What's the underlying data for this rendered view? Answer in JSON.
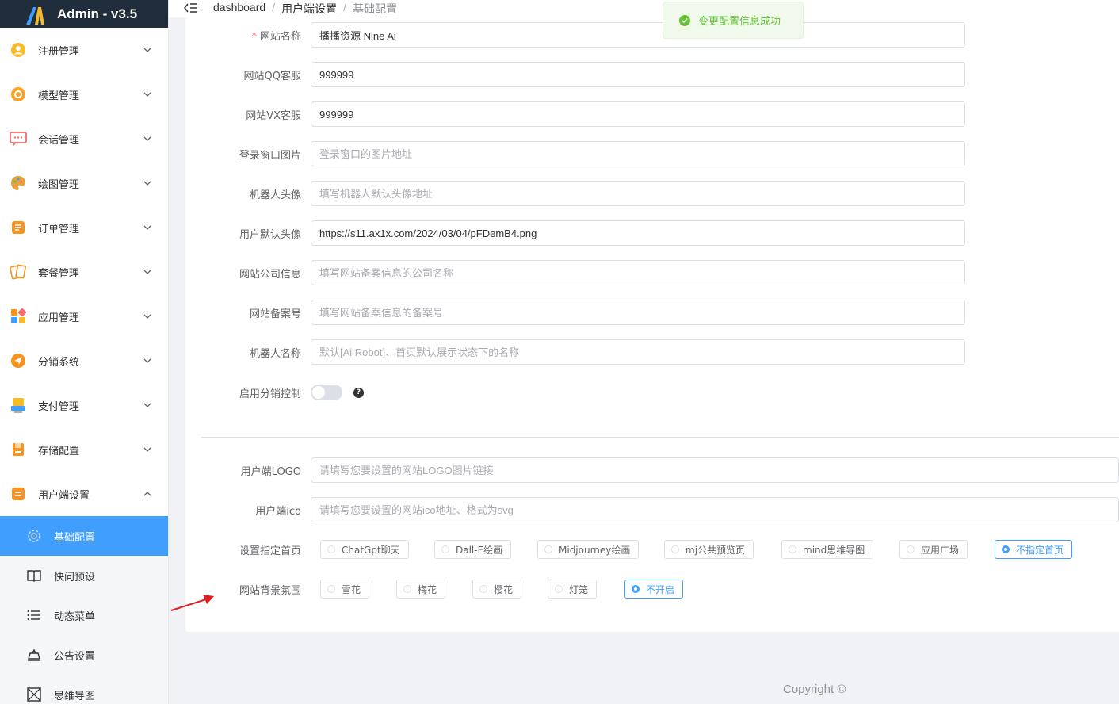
{
  "app": {
    "title": "Admin - v3.5"
  },
  "breadcrumb": [
    "dashboard",
    "用户端设置",
    "基础配置"
  ],
  "toast": {
    "message": "变更配置信息成功"
  },
  "sidebar": {
    "items": [
      {
        "label": "注册管理",
        "icon": "user-circle-icon",
        "color": "#f7ba2a"
      },
      {
        "label": "模型管理",
        "icon": "model-icon",
        "color": "#f7a32a"
      },
      {
        "label": "会话管理",
        "icon": "chat-icon",
        "color": "#f56c6c"
      },
      {
        "label": "绘图管理",
        "icon": "palette-icon",
        "color": "#e6a23c"
      },
      {
        "label": "订单管理",
        "icon": "order-icon",
        "color": "#f56c6c"
      },
      {
        "label": "套餐管理",
        "icon": "package-icon",
        "color": "#e6a23c"
      },
      {
        "label": "应用管理",
        "icon": "apps-icon",
        "color": "#f7931e"
      },
      {
        "label": "分销系统",
        "icon": "send-icon",
        "color": "#f7931e"
      },
      {
        "label": "支付管理",
        "icon": "pay-icon",
        "color": "#e6a23c"
      },
      {
        "label": "存储配置",
        "icon": "storage-icon",
        "color": "#f7931e"
      },
      {
        "label": "用户端设置",
        "icon": "client-icon",
        "color": "#f7931e"
      }
    ],
    "sub_items": [
      {
        "label": "基础配置",
        "icon": "gear-icon"
      },
      {
        "label": "快问预设",
        "icon": "book-icon"
      },
      {
        "label": "动态菜单",
        "icon": "list-icon"
      },
      {
        "label": "公告设置",
        "icon": "announce-icon"
      },
      {
        "label": "思维导图",
        "icon": "mindmap-icon"
      }
    ]
  },
  "form": {
    "fields": [
      {
        "label": "网站名称",
        "required": "*",
        "value": "播播资源 Nine Ai",
        "placeholder": ""
      },
      {
        "label": "网站QQ客服",
        "value": "999999",
        "placeholder": ""
      },
      {
        "label": "网站VX客服",
        "value": "999999",
        "placeholder": ""
      },
      {
        "label": "登录窗口图片",
        "value": "",
        "placeholder": "登录窗口的图片地址"
      },
      {
        "label": "机器人头像",
        "value": "",
        "placeholder": "填写机器人默认头像地址"
      },
      {
        "label": "用户默认头像",
        "value": "https://s11.ax1x.com/2024/03/04/pFDemB4.png",
        "placeholder": ""
      },
      {
        "label": "网站公司信息",
        "value": "",
        "placeholder": "填写网站备案信息的公司名称"
      },
      {
        "label": "网站备案号",
        "value": "",
        "placeholder": "填写网站备案信息的备案号"
      },
      {
        "label": "机器人名称",
        "value": "",
        "placeholder": "默认[Ai Robot]、首页默认展示状态下的名称"
      }
    ],
    "switch_label": "启用分销控制",
    "help_mark": "?",
    "logo": {
      "label": "用户端LOGO",
      "placeholder": "请填写您要设置的网站LOGO图片链接"
    },
    "ico": {
      "label": "用户端ico",
      "placeholder": "请填写您要设置的网站ico地址、格式为svg"
    },
    "homepage": {
      "label": "设置指定首页",
      "options": [
        "ChatGpt聊天",
        "Dall-E绘画",
        "Midjourney绘画",
        "mj公共预览页",
        "mind思维导图",
        "应用广场",
        "不指定首页"
      ],
      "selected": "不指定首页"
    },
    "background": {
      "label": "网站背景氛围",
      "options": [
        "雪花",
        "梅花",
        "樱花",
        "灯笼",
        "不开启"
      ],
      "selected": "不开启"
    }
  },
  "footer": {
    "copyright": "Copyright ©"
  },
  "colors": {
    "primary": "#409eff",
    "success": "#67c23a",
    "sidebar_brand_bg": "#1f2d3d"
  }
}
